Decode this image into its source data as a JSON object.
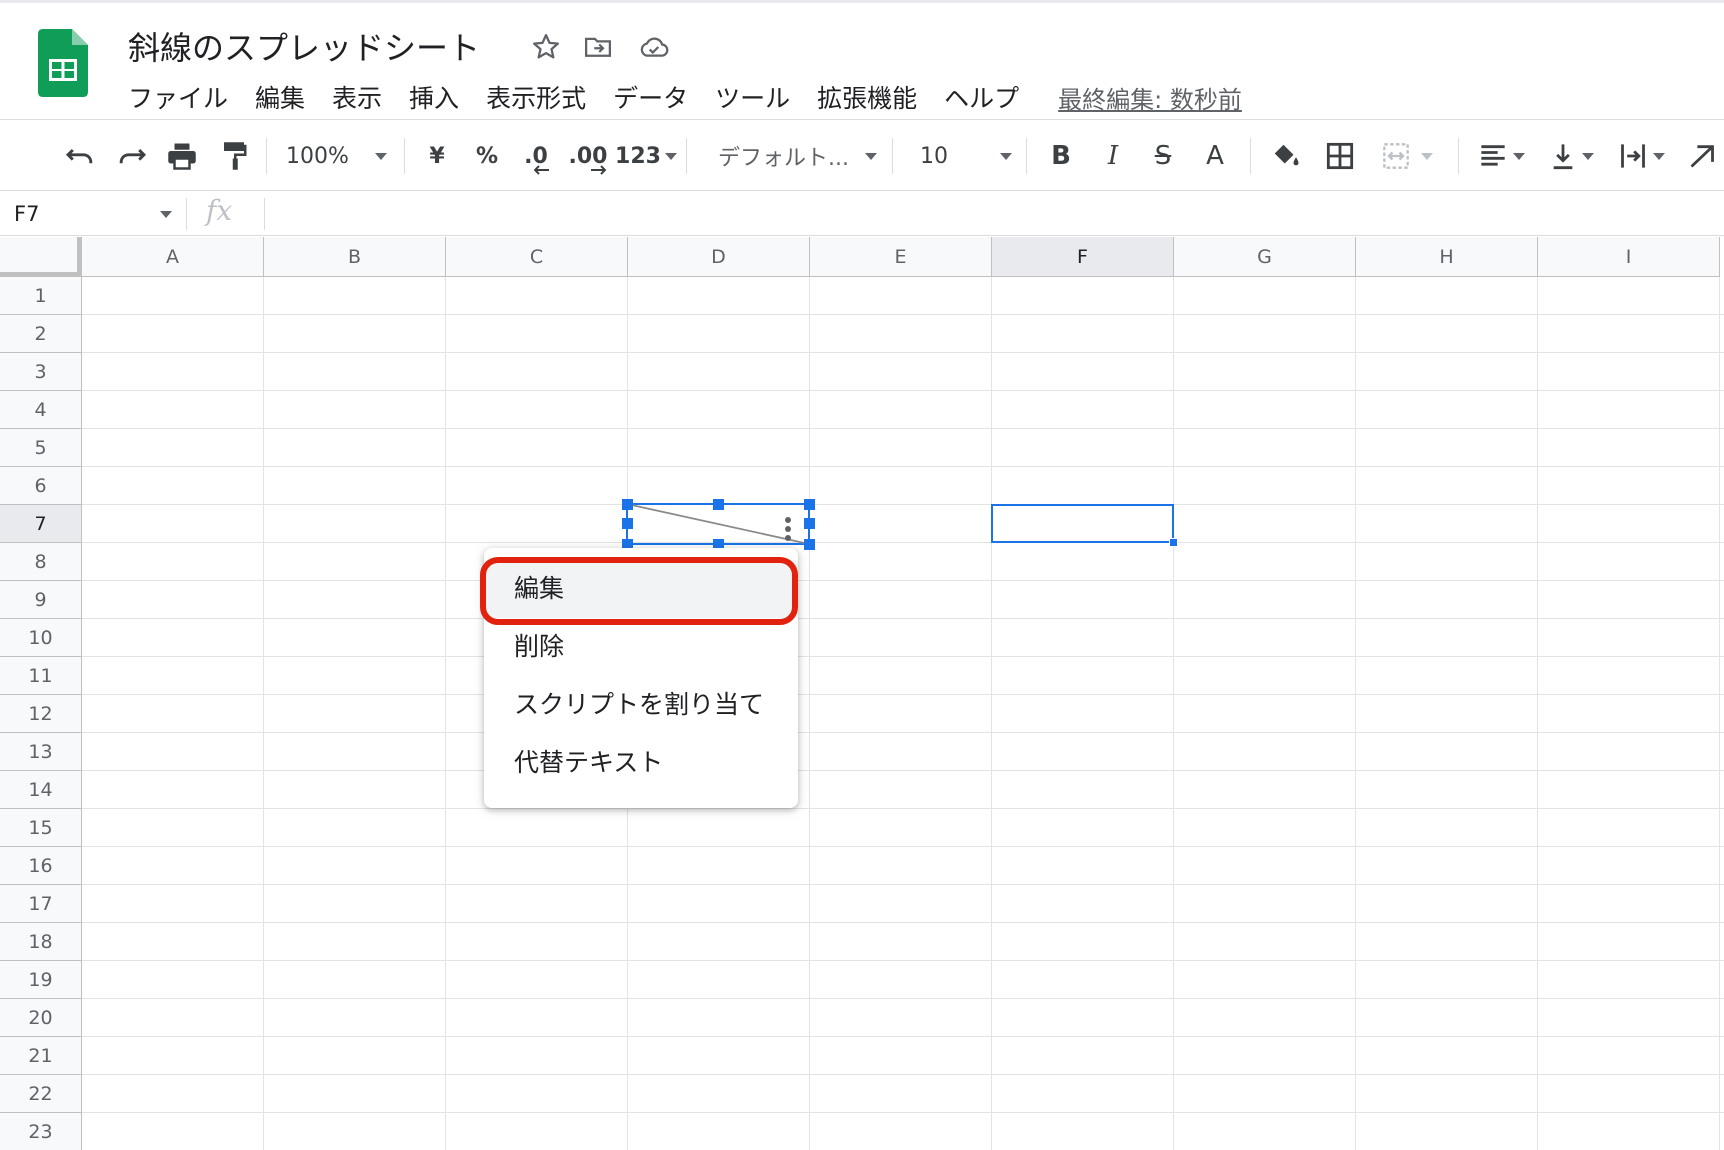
{
  "document": {
    "title": "斜線のスプレッドシート"
  },
  "menubar": {
    "items": [
      "ファイル",
      "編集",
      "表示",
      "挿入",
      "表示形式",
      "データ",
      "ツール",
      "拡張機能",
      "ヘルプ"
    ],
    "last_edit": "最終編集: 数秒前"
  },
  "toolbar": {
    "zoom": "100%",
    "currency": "¥",
    "percent": "%",
    "decimal_decrease": ".0",
    "decimal_increase": ".00",
    "number_format": "123",
    "font": "デフォルト...",
    "font_size": "10",
    "bold": "B",
    "italic": "I",
    "strike": "S",
    "text_color": "A"
  },
  "formula_bar": {
    "name_box": "F7",
    "fx": "fx",
    "value": ""
  },
  "grid": {
    "columns": [
      "A",
      "B",
      "C",
      "D",
      "E",
      "F",
      "G",
      "H",
      "I"
    ],
    "rows": [
      "1",
      "2",
      "3",
      "4",
      "5",
      "6",
      "7",
      "8",
      "9",
      "10",
      "11",
      "12",
      "13",
      "14",
      "15",
      "16",
      "17",
      "18",
      "19",
      "20",
      "21",
      "22",
      "23"
    ],
    "active_column": "F",
    "active_row": "7",
    "selected_cell": "F7"
  },
  "context_menu": {
    "items": [
      "編集",
      "削除",
      "スクリプトを割り当て",
      "代替テキスト"
    ],
    "highlighted": "編集"
  },
  "colors": {
    "sheets_green": "#0f9d58",
    "selection_blue": "#1a73e8",
    "annotation_red": "#e0220f"
  }
}
